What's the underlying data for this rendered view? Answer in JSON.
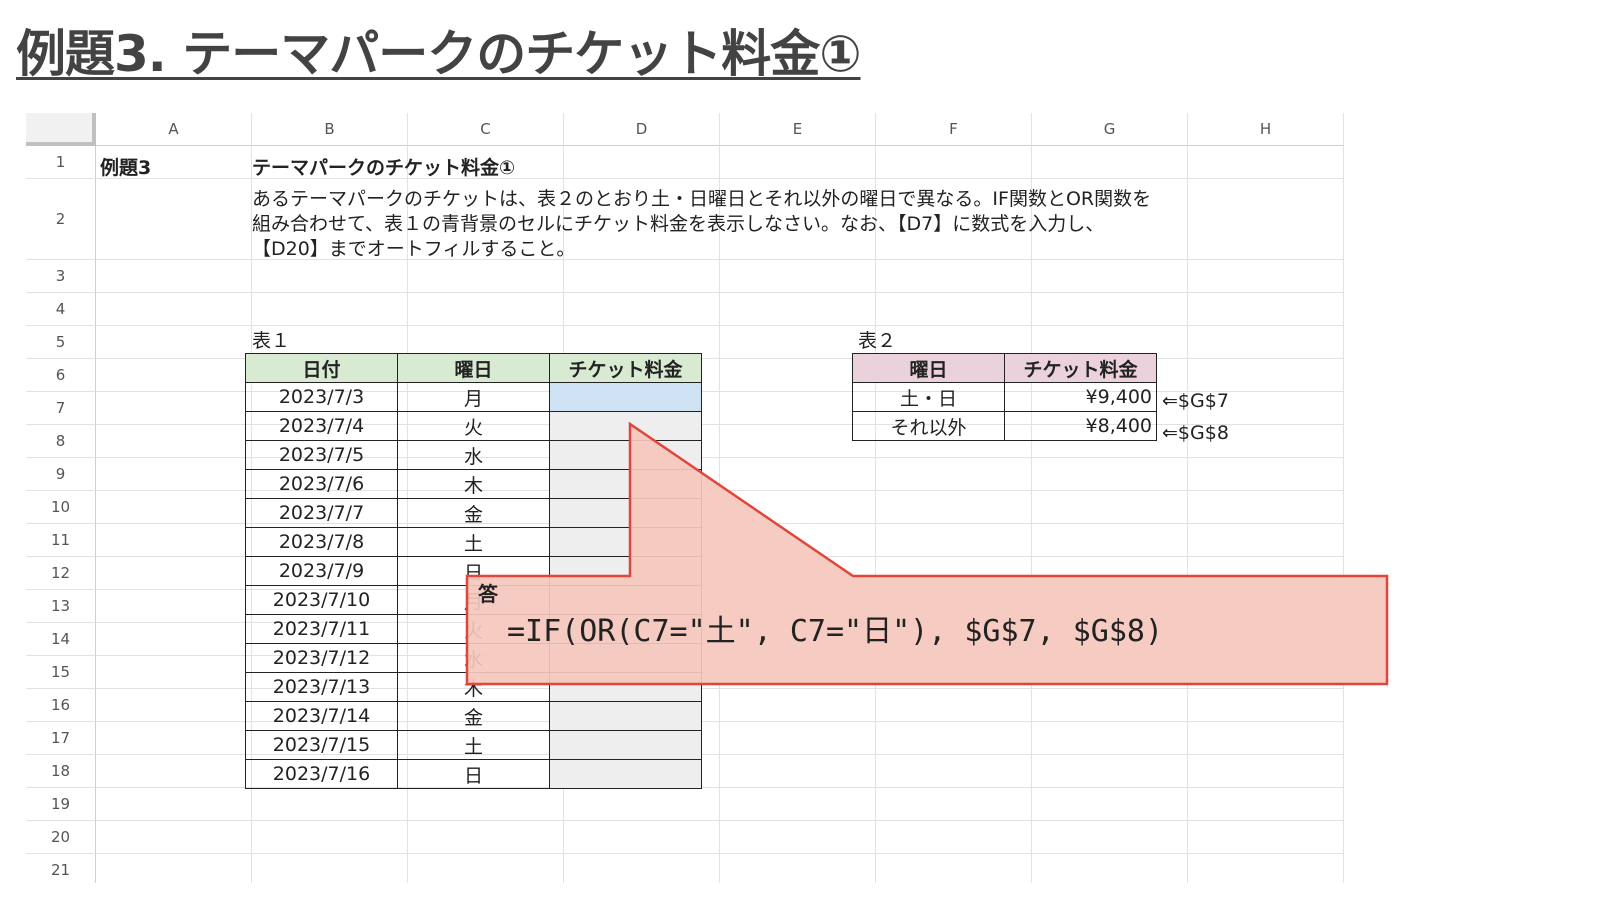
{
  "title": "例題3. テーマパークのチケット料金①",
  "sheet": {
    "columns": [
      "A",
      "B",
      "C",
      "D",
      "E",
      "F",
      "G",
      "H"
    ],
    "rows": [
      "1",
      "2",
      "3",
      "4",
      "5",
      "6",
      "7",
      "8",
      "9",
      "10",
      "11",
      "12",
      "13",
      "14",
      "15",
      "16",
      "17",
      "18",
      "19",
      "20",
      "21"
    ],
    "a1": "例題3",
    "b1": "テーマパークのチケット料金①",
    "description": "あるテーマパークのチケットは、表２のとおり土・日曜日とそれ以外の曜日で異なる。IF関数とOR関数を組み合わせて、表１の青背景のセルにチケット料金を表示しなさい。なお、【D7】に数式を入力し、【D20】までオートフィルすること。",
    "table1": {
      "label": "表１",
      "headers": [
        "日付",
        "曜日",
        "チケット料金"
      ],
      "rows": [
        {
          "date": "2023/7/3",
          "dow": "月"
        },
        {
          "date": "2023/7/4",
          "dow": "火"
        },
        {
          "date": "2023/7/5",
          "dow": "水"
        },
        {
          "date": "2023/7/6",
          "dow": "木"
        },
        {
          "date": "2023/7/7",
          "dow": "金"
        },
        {
          "date": "2023/7/8",
          "dow": "土"
        },
        {
          "date": "2023/7/9",
          "dow": "日"
        },
        {
          "date": "2023/7/10",
          "dow": "月"
        },
        {
          "date": "2023/7/11",
          "dow": "火"
        },
        {
          "date": "2023/7/12",
          "dow": "水"
        },
        {
          "date": "2023/7/13",
          "dow": "木"
        },
        {
          "date": "2023/7/14",
          "dow": "金"
        },
        {
          "date": "2023/7/15",
          "dow": "土"
        },
        {
          "date": "2023/7/16",
          "dow": "日"
        }
      ]
    },
    "table2": {
      "label": "表２",
      "headers": [
        "曜日",
        "チケット料金"
      ],
      "rows": [
        {
          "dow": "土・日",
          "fee": "¥9,400",
          "ref": "⇐$G$7"
        },
        {
          "dow": "それ以外",
          "fee": "¥8,400",
          "ref": "⇐$G$8"
        }
      ]
    }
  },
  "answer": {
    "label": "答",
    "formula": "=IF(OR(C7=\"土\", C7=\"日\"), $G$7, $G$8)"
  },
  "colors": {
    "table1_header": "#d9ead3",
    "table2_header": "#ead1dc",
    "active_cell": "#cfe2f3",
    "fee_cell": "#eeeeee",
    "callout_fill": "#f4c7bd",
    "callout_border": "#e0463c"
  }
}
